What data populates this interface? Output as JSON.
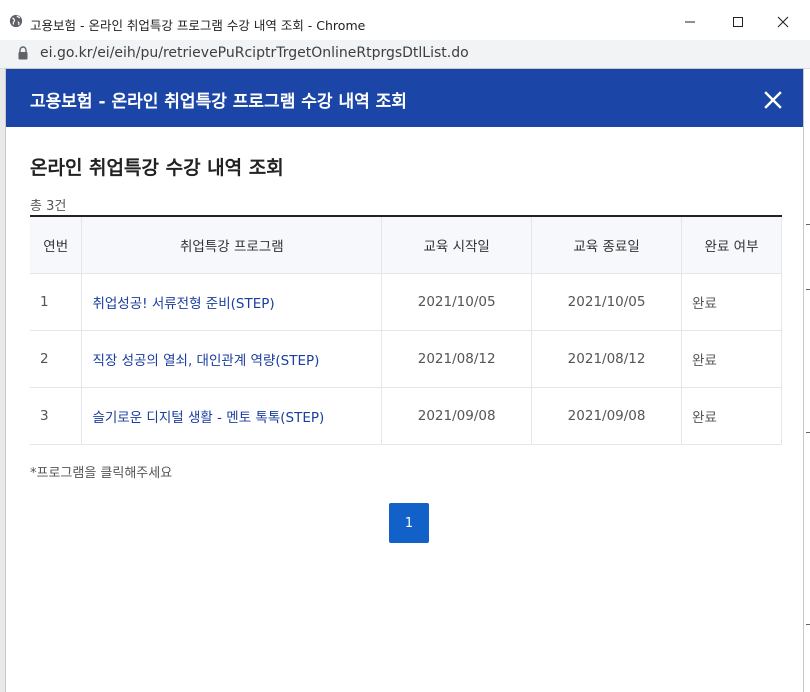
{
  "browser": {
    "window_title": "고용보험 - 온라인 취업특강 프로그램 수강 내역 조회 - Chrome",
    "url": "ei.go.kr/ei/eih/pu/retrievePuRciptrTrgetOnlineRtprgsDtlList.do"
  },
  "modal": {
    "header_title": "고용보험 - 온라인 취업특강 프로그램 수강 내역 조회",
    "section_title": "온라인 취업특강 수강 내역 조회",
    "total_label": "총 3건",
    "hint": "*프로그램을 클릭해주세요"
  },
  "table": {
    "headers": [
      "연번",
      "취업특강 프로그램",
      "교육 시작일",
      "교육 종료일",
      "완료 여부"
    ],
    "rows": [
      {
        "no": "1",
        "program": "취업성공! 서류전형 준비(STEP)",
        "start": "2021/10/05",
        "end": "2021/10/05",
        "status": "완료"
      },
      {
        "no": "2",
        "program": "직장 성공의 열쇠, 대인관계 역량(STEP)",
        "start": "2021/08/12",
        "end": "2021/08/12",
        "status": "완료"
      },
      {
        "no": "3",
        "program": "슬기로운 디지털 생활 - 멘토 톡톡(STEP)",
        "start": "2021/09/08",
        "end": "2021/09/08",
        "status": "완료"
      }
    ]
  },
  "pagination": {
    "current_page": "1"
  },
  "colors": {
    "header_bg": "#1b45a6",
    "link": "#1a3ea0",
    "page_button": "#1161c9"
  },
  "icons": {
    "tab": "globe-icon",
    "address": "lock-icon",
    "modal_close": "close-icon"
  }
}
